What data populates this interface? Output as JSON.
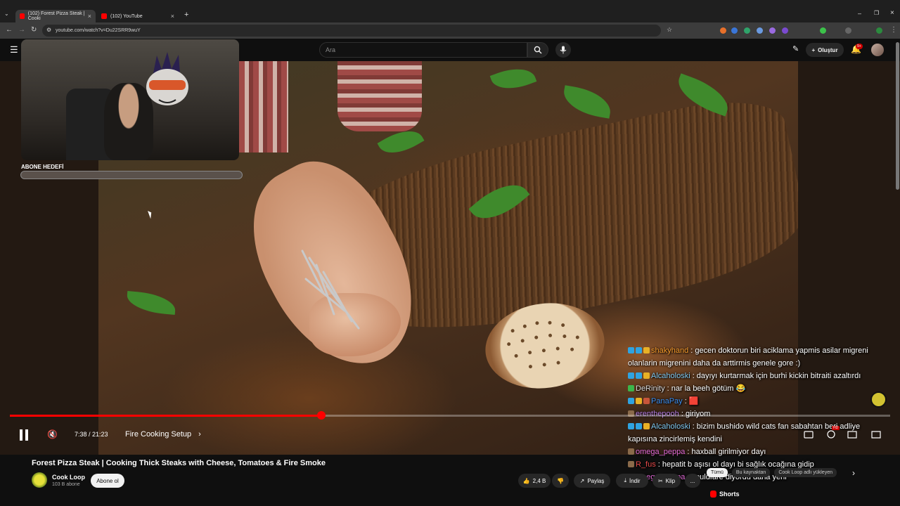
{
  "browser": {
    "tabs": [
      {
        "label": "(102) Forest Pizza Steak | Cooki",
        "active": true
      },
      {
        "label": "(102) YouTube",
        "active": false
      }
    ],
    "url": "youtube.com/watch?v=Du22SRR9wuY"
  },
  "header": {
    "search_placeholder": "Ara",
    "create_label": "Oluştur",
    "notifications_count": "9+"
  },
  "overlay": {
    "goal_label": "ABONE HEDEFİ",
    "goal_count": ""
  },
  "player": {
    "time": "7:38 / 21:23",
    "chapter": "Fire Cooking Setup",
    "progress_fraction": 0.354,
    "hd_badge": "HD"
  },
  "chat": [
    {
      "user": "shakyhand",
      "user_color": "#f59a2b",
      "text": " : gecen doktorun biri aciklama yapmis asilar migreni olanlarin migrenini daha da arttirmis genele gore :)",
      "wrap": true,
      "badges": [
        "#2fa3e0",
        "#2fa3e0",
        "#e8b125"
      ]
    },
    {
      "user": "Alcaholoski",
      "user_color": "#7ec8f0",
      "text": " : dayıyı kurtarmak için burhi kickin bitraiti azaltırdı",
      "wrap": false,
      "badges": [
        "#2fa3e0",
        "#2fa3e0",
        "#e8b125"
      ]
    },
    {
      "user": "DeRinity",
      "user_color": "#d8d8d8",
      "text": " : nar la beeh götüm 😂",
      "wrap": false,
      "badges": [
        "#3cb54a"
      ]
    },
    {
      "user": "PanaPay",
      "user_color": "#3a8ef0",
      "text": " : 🟥",
      "wrap": false,
      "badges": [
        "#2fa3e0",
        "#e8b125",
        "#c7553a"
      ]
    },
    {
      "user": "erenthepooh",
      "user_color": "#b57ce0",
      "text": " : giriyom",
      "wrap": false,
      "badges": [
        "#8a6a4a"
      ]
    },
    {
      "user": "Alcaholoski",
      "user_color": "#7ec8f0",
      "text": " : bizim bushido wild cats fan sabahtan beri adliye kapısına zincirlemiş kendini",
      "wrap": true,
      "badges": [
        "#2fa3e0",
        "#2fa3e0",
        "#e8b125"
      ]
    },
    {
      "user": "omega_peppa",
      "user_color": "#e06ad6",
      "text": " : haxball girilmiyor dayı",
      "wrap": false,
      "badges": [
        "#8a6a4a"
      ]
    },
    {
      "user": "R_fus",
      "user_color": "#e84a4a",
      "text": " : hepatit b aşısı ol dayı bi sağlık ocağına gidip",
      "wrap": false,
      "badges": [
        "#8a6a4a"
      ]
    },
    {
      "user": "omega_peppa",
      "user_color": "#e06ad6",
      "text": " : couldfare diyordu daha yeni",
      "wrap": false,
      "badges": [
        "#8a6a4a"
      ]
    }
  ],
  "video": {
    "title": "Forest Pizza Steak | Cooking Thick Steaks with Cheese, Tomatoes & Fire Smoke",
    "channel": "Cook Loop",
    "subscribers": "103 B abone",
    "subscribe_label": "Abone ol",
    "likes": "2,4 B",
    "share_label": "Paylaş",
    "download_label": "İndir",
    "clip_label": "Klip",
    "more_label": "...",
    "shorts_label": "Shorts",
    "chips": [
      "Tümü",
      "Bu kaynaktan",
      "Cook Loop adlı yükleyen"
    ]
  }
}
